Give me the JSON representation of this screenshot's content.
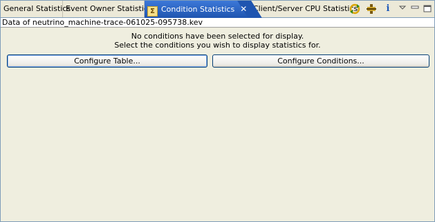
{
  "tabs": [
    {
      "label": "General Statistics"
    },
    {
      "label": "Event Owner Statistics"
    },
    {
      "label": "Condition Statistics",
      "active": true,
      "icon": "sigma-icon"
    },
    {
      "label": "Client/Server CPU Statistics"
    }
  ],
  "toolbar": {
    "icons": [
      "refresh-icon",
      "debug-icon",
      "info-icon",
      "view-menu-icon",
      "minimize-icon",
      "maximize-icon"
    ],
    "info_glyph": "i"
  },
  "path_label": "Data of neutrino_machine-trace-061025-095738.kev",
  "message": {
    "line1": "No conditions have been selected for display.",
    "line2": "Select the conditions you wish to display statistics for."
  },
  "buttons": {
    "configure_table": "Configure Table...",
    "configure_conditions": "Configure Conditions..."
  },
  "colors": {
    "active_tab": "#2d66c4",
    "panel_background": "#efeedf",
    "border": "#7f9db9"
  }
}
